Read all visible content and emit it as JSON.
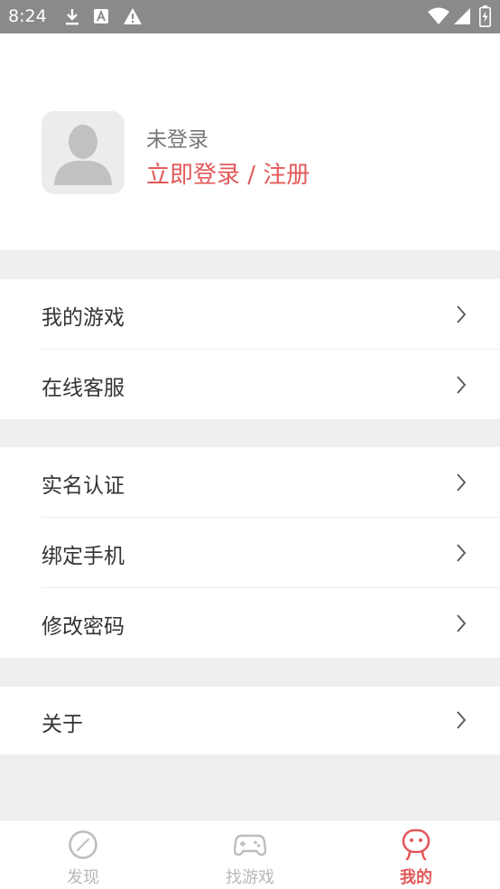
{
  "status_bar": {
    "time": "8:24",
    "icons": [
      "download-icon",
      "app-a-icon",
      "warning-icon",
      "wifi-icon",
      "signal-icon",
      "battery-charging-icon"
    ]
  },
  "profile": {
    "status": "未登录",
    "login_action": "立即登录 / 注册",
    "avatar_icon": "default-avatar-icon"
  },
  "menu_groups": [
    {
      "items": [
        {
          "label": "我的游戏"
        },
        {
          "label": "在线客服"
        }
      ]
    },
    {
      "items": [
        {
          "label": "实名认证"
        },
        {
          "label": "绑定手机"
        },
        {
          "label": "修改密码"
        }
      ]
    },
    {
      "items": [
        {
          "label": "关于"
        }
      ]
    }
  ],
  "tabbar": {
    "tabs": [
      {
        "label": "发现",
        "icon": "compass-icon",
        "active": false
      },
      {
        "label": "找游戏",
        "icon": "gamepad-icon",
        "active": false
      },
      {
        "label": "我的",
        "icon": "person-face-icon",
        "active": true
      }
    ]
  },
  "colors": {
    "accent": "#e2595a",
    "status_bar": "#8a8a8a",
    "background": "#f0efee"
  }
}
